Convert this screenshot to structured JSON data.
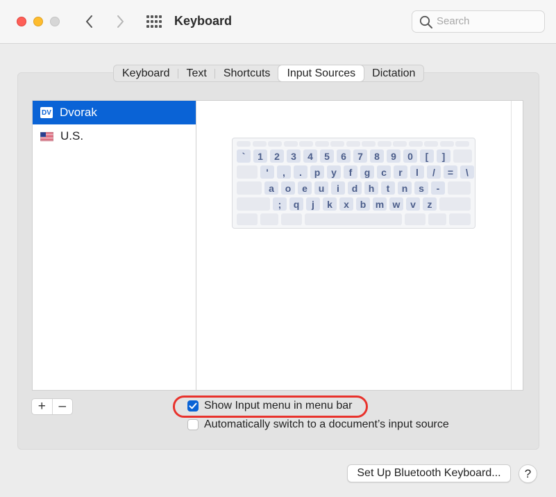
{
  "window": {
    "title": "Keyboard",
    "search_placeholder": "Search"
  },
  "tabs": [
    {
      "label": "Keyboard",
      "active": false
    },
    {
      "label": "Text",
      "active": false
    },
    {
      "label": "Shortcuts",
      "active": false
    },
    {
      "label": "Input Sources",
      "active": true
    },
    {
      "label": "Dictation",
      "active": false
    }
  ],
  "input_sources": [
    {
      "label": "Dvorak",
      "badge": "DV",
      "selected": true
    },
    {
      "label": "U.S.",
      "icon": "us-flag-icon",
      "selected": false
    }
  ],
  "keyboard_layout": {
    "row1": [
      "`",
      "1",
      "2",
      "3",
      "4",
      "5",
      "6",
      "7",
      "8",
      "9",
      "0",
      "[",
      "]"
    ],
    "row2": [
      "'",
      ",",
      ".",
      "p",
      "y",
      "f",
      "g",
      "c",
      "r",
      "l",
      "/",
      "=",
      "\\"
    ],
    "row3": [
      "a",
      "o",
      "e",
      "u",
      "i",
      "d",
      "h",
      "t",
      "n",
      "s",
      "-"
    ],
    "row4": [
      ";",
      "q",
      "j",
      "k",
      "x",
      "b",
      "m",
      "w",
      "v",
      "z"
    ]
  },
  "list_controls": {
    "add": "+",
    "remove": "–"
  },
  "options": {
    "show_input_menu": {
      "label": "Show Input menu in menu bar",
      "checked": true
    },
    "auto_switch": {
      "label": "Automatically switch to a document’s input source",
      "checked": false
    }
  },
  "buttons": {
    "bluetooth": "Set Up Bluetooth Keyboard...",
    "help": "?"
  },
  "colors": {
    "accent": "#0a63d6",
    "highlight_ring": "#e8322c"
  }
}
